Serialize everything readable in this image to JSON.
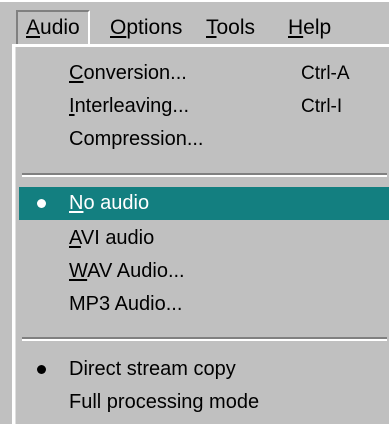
{
  "menubar": {
    "items": [
      {
        "label_first": "A",
        "label_rest": "udio"
      },
      {
        "label_first": "O",
        "label_rest": "ptions"
      },
      {
        "label_first": "T",
        "label_rest": "ools"
      },
      {
        "label_first": "H",
        "label_rest": "elp"
      }
    ]
  },
  "audio_menu": {
    "items": [
      {
        "pre": "",
        "key": "C",
        "post": "onversion...",
        "shortcut": "Ctrl-A"
      },
      {
        "pre": "",
        "key": "I",
        "post": "nterleaving...",
        "shortcut": "Ctrl-I"
      },
      {
        "pre": "Compression...",
        "key": "",
        "post": "",
        "shortcut": ""
      },
      {
        "pre": "",
        "key": "N",
        "post": "o audio",
        "shortcut": "",
        "checked": true,
        "highlighted": true
      },
      {
        "pre": "",
        "key": "A",
        "post": "VI audio",
        "shortcut": ""
      },
      {
        "pre": "",
        "key": "W",
        "post": "AV Audio...",
        "shortcut": ""
      },
      {
        "pre": "MP3 Audio...",
        "key": "",
        "post": "",
        "shortcut": ""
      },
      {
        "pre": "Direct stream copy",
        "key": "",
        "post": "",
        "shortcut": "",
        "checked": true
      },
      {
        "pre": "Full processing mode",
        "key": "",
        "post": "",
        "shortcut": ""
      }
    ]
  },
  "colors": {
    "menu_bg": "#c0c0c0",
    "highlight_bg": "#137f80",
    "highlight_text": "#ffffff"
  }
}
